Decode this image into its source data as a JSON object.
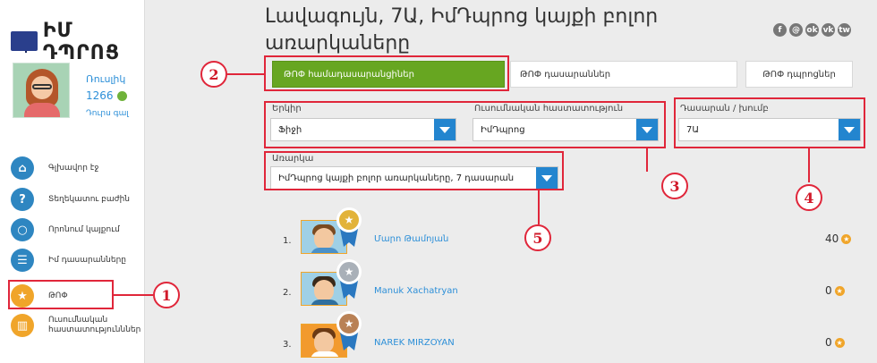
{
  "logo": {
    "text": "ԻՄ ԴՊՐՈՑ"
  },
  "user": {
    "name": "Ռուսլիկ",
    "points": "1266",
    "logout": "Դուրս գալ"
  },
  "nav": [
    {
      "label": "Գլխավոր էջ",
      "icon": "home-icon"
    },
    {
      "label": "Տեղեկատու բաժին",
      "icon": "question-icon"
    },
    {
      "label": "Որոնում կայքում",
      "icon": "search-icon"
    },
    {
      "label": "Իմ դասարանները",
      "icon": "class-icon"
    },
    {
      "label": "ԹՈՓ",
      "icon": "star-icon"
    },
    {
      "label": "Ուսումնական հաստատությունններ",
      "icon": "building-icon"
    }
  ],
  "page": {
    "title": "Լավագույն, 7Ա, ԻմԴպրոց կայքի բոլոր առարկաները"
  },
  "socials": [
    "f",
    "@",
    "ok",
    "vk",
    "tw"
  ],
  "tabs": {
    "students": "ԹՈՓ համադասարանցիներ",
    "classes": "ԹՈՓ դասարաններ",
    "schools": "ԹՈՓ դպրոցներ"
  },
  "filters": {
    "country_label": "Երկիր",
    "country_value": "Ֆիջի",
    "institution_label": "Ուսումնական հաստատություն",
    "institution_value": "ԻմԴպրոց",
    "class_label": "Դասարան / խումբ",
    "class_value": "7Ա",
    "subject_label": "Առարկա",
    "subject_value": "ԻմԴպրոց կայքի բոլոր առարկաները, 7 դասարան"
  },
  "annotations": [
    "1",
    "2",
    "3",
    "4",
    "5"
  ],
  "ranking": [
    {
      "rank": "1.",
      "name": "Մարո Թամոյան",
      "score": "40",
      "medal": "gold"
    },
    {
      "rank": "2.",
      "name": "Manuk Xachatryan",
      "score": "0",
      "medal": "silver"
    },
    {
      "rank": "3.",
      "name": "NAREK MIRZOYAN",
      "score": "0",
      "medal": "bronze"
    }
  ],
  "colors": {
    "accent_green": "#67a621",
    "select_blue": "#2385cf",
    "annotation_red": "#e0263a",
    "star_orange": "#f0a52a"
  }
}
